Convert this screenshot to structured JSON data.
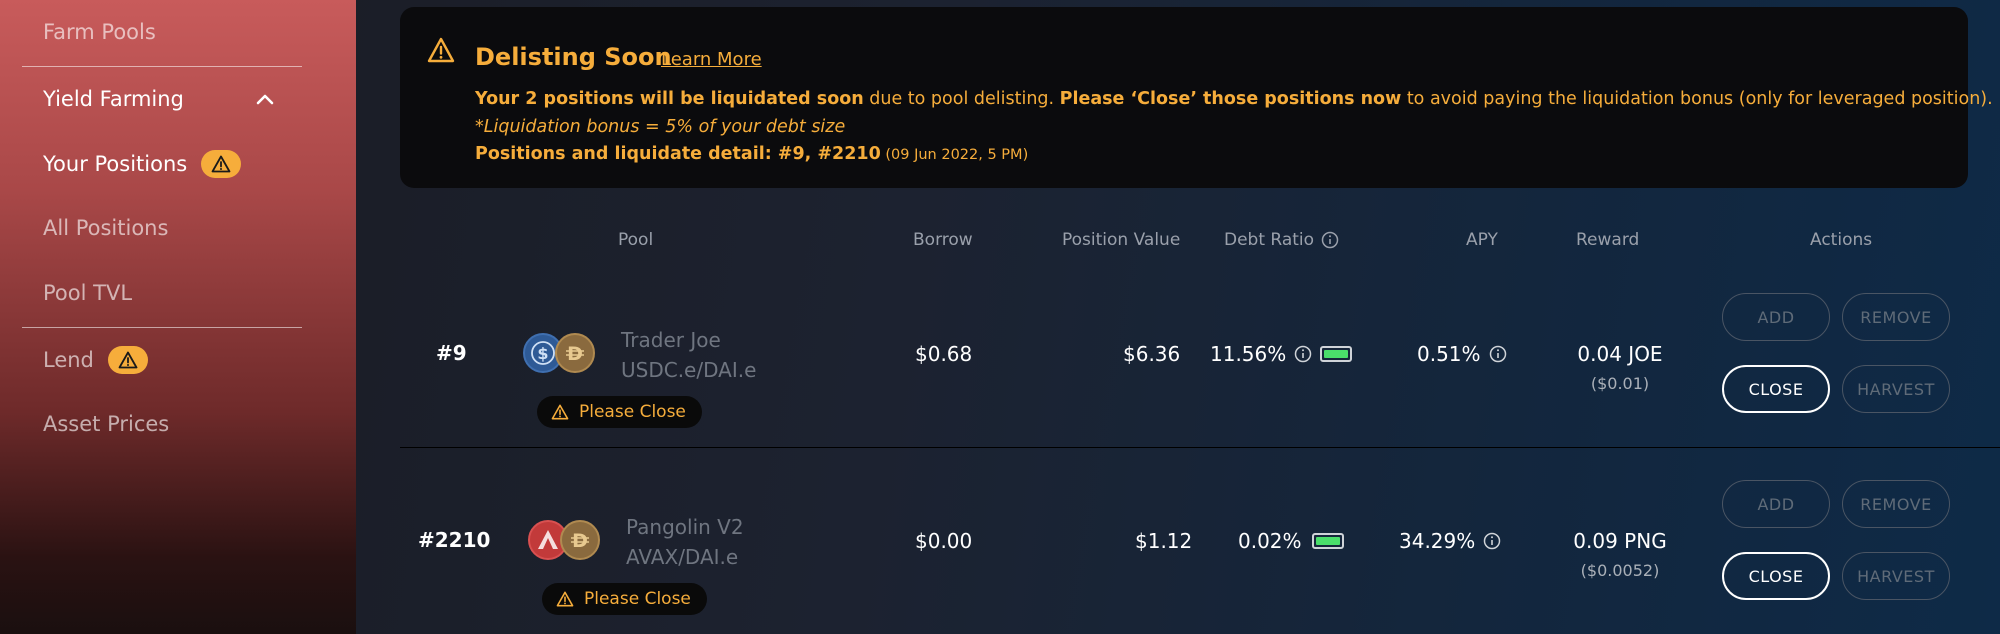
{
  "sidebar": {
    "farm_pools": "Farm Pools",
    "yield_farming": "Yield Farming",
    "your_positions": "Your Positions",
    "all_positions": "All Positions",
    "pool_tvl": "Pool TVL",
    "lend": "Lend",
    "asset_prices": "Asset Prices"
  },
  "banner": {
    "title": "Delisting Soon",
    "link": "Learn More",
    "line1_bold1": "Your 2 positions will be liquidated soon",
    "line1_text1": " due to pool delisting. ",
    "line1_bold2": "Please ‘Close’ those positions now",
    "line1_text2": " to avoid paying the liquidation bonus (only for leveraged position).",
    "line2": "*Liquidation bonus = 5% of your debt size",
    "line3_bold": "Positions and liquidate detail: #9, #2210",
    "line3_small": " (09 Jun 2022, 5 PM)"
  },
  "table": {
    "headers": {
      "pool": "Pool",
      "borrow": "Borrow",
      "position_value": "Position Value",
      "debt_ratio": "Debt Ratio",
      "apy": "APY",
      "reward": "Reward",
      "actions": "Actions"
    },
    "rows": [
      {
        "id": "#9",
        "protocol": "Trader Joe",
        "pair": "USDC.e/DAI.e",
        "please_close": "Please Close",
        "borrow": "$0.68",
        "position_value": "$6.36",
        "debt_ratio": "11.56%",
        "apy": "0.51%",
        "reward": "0.04 JOE",
        "reward_usd": "($0.01)"
      },
      {
        "id": "#2210",
        "protocol": "Pangolin V2",
        "pair": "AVAX/DAI.e",
        "please_close": "Please Close",
        "borrow": "$0.00",
        "position_value": "$1.12",
        "debt_ratio": "0.02%",
        "apy": "34.29%",
        "reward": "0.09 PNG",
        "reward_usd": "($0.0052)"
      }
    ]
  },
  "actions": {
    "add": "ADD",
    "remove": "REMOVE",
    "close": "CLOSE",
    "harvest": "HARVEST"
  },
  "colors": {
    "accent": "#f6ad3b",
    "healthy": "#4ade6a"
  }
}
